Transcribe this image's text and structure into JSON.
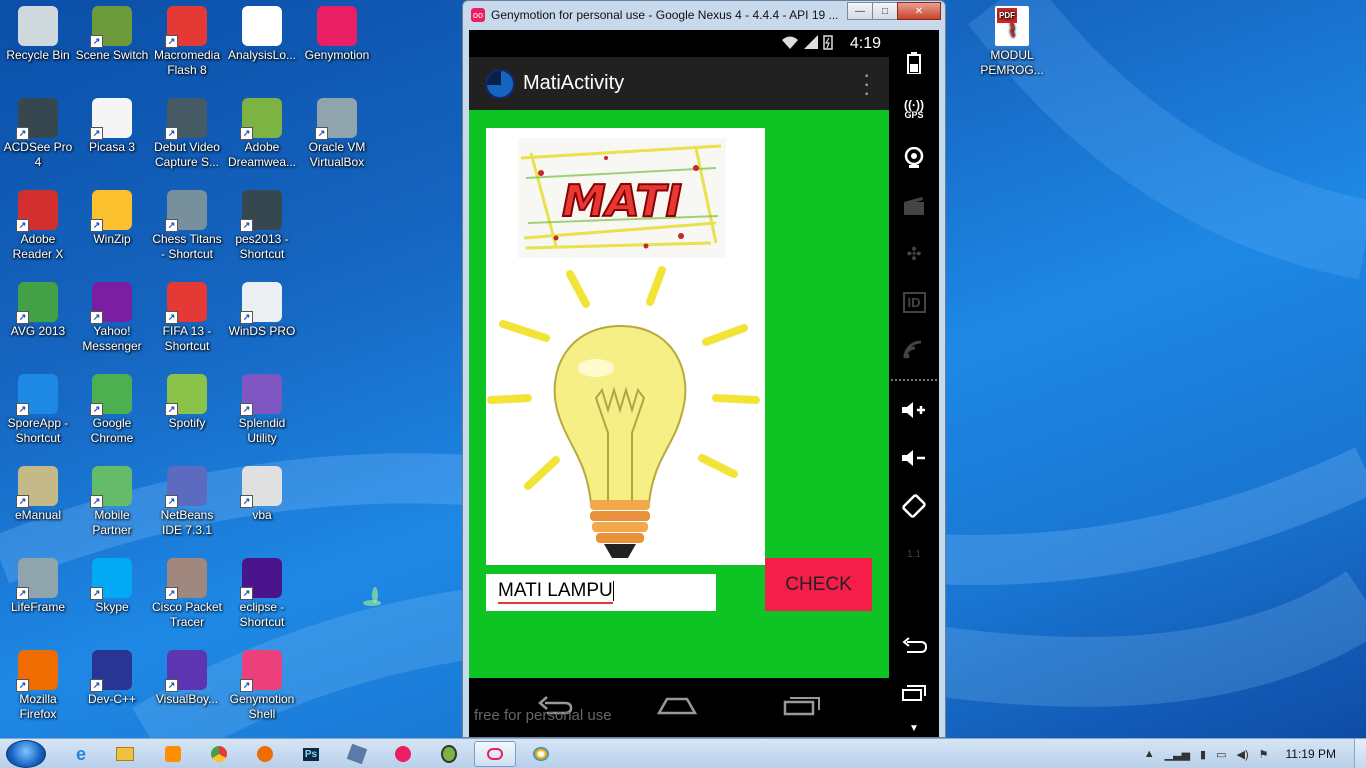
{
  "desktop": {
    "col1": [
      {
        "label": "Recycle Bin",
        "icon": "recycle-bin-icon",
        "color": "#cfd8dc"
      },
      {
        "label": "ACDSee Pro 4",
        "icon": "acdsee-icon",
        "color": "#37474f"
      },
      {
        "label": "Adobe Reader X",
        "icon": "adobe-reader-icon",
        "color": "#d32f2f"
      },
      {
        "label": "AVG 2013",
        "icon": "avg-icon",
        "color": "#43a047"
      },
      {
        "label": "SporeApp - Shortcut",
        "icon": "sporeapp-icon",
        "color": "#1e88e5"
      },
      {
        "label": "eManual",
        "icon": "emanual-icon",
        "color": "#c5b98a"
      },
      {
        "label": "LifeFrame",
        "icon": "lifeframe-icon",
        "color": "#90a4ae"
      },
      {
        "label": "Mozilla Firefox",
        "icon": "firefox-icon",
        "color": "#ef6c00"
      }
    ],
    "col2": [
      {
        "label": "Scene Switch",
        "icon": "scene-switch-icon",
        "color": "#6d9b3c"
      },
      {
        "label": "Picasa 3",
        "icon": "picasa-icon",
        "color": "#f5f5f5"
      },
      {
        "label": "WinZip",
        "icon": "winzip-icon",
        "color": "#fbc02d"
      },
      {
        "label": "Yahoo! Messenger",
        "icon": "yahoo-messenger-icon",
        "color": "#7b1fa2"
      },
      {
        "label": "Google Chrome",
        "icon": "chrome-icon",
        "color": "#4caf50"
      },
      {
        "label": "Mobile Partner",
        "icon": "mobile-partner-icon",
        "color": "#66bb6a"
      },
      {
        "label": "Skype",
        "icon": "skype-icon",
        "color": "#03a9f4"
      },
      {
        "label": "Dev-C++",
        "icon": "dev-cpp-icon",
        "color": "#283593"
      }
    ],
    "col3": [
      {
        "label": "Macromedia Flash 8",
        "icon": "flash-icon",
        "color": "#e53935"
      },
      {
        "label": "Debut Video Capture S...",
        "icon": "debut-video-icon",
        "color": "#455a64"
      },
      {
        "label": "Chess Titans - Shortcut",
        "icon": "chess-titans-icon",
        "color": "#78909c"
      },
      {
        "label": "FIFA 13 - Shortcut",
        "icon": "fifa-icon",
        "color": "#e53935"
      },
      {
        "label": "Spotify",
        "icon": "spotify-icon",
        "color": "#8bc34a"
      },
      {
        "label": "NetBeans IDE 7.3.1",
        "icon": "netbeans-icon",
        "color": "#5c6bc0"
      },
      {
        "label": "Cisco Packet Tracer",
        "icon": "cisco-packet-tracer-icon",
        "color": "#a1887f"
      },
      {
        "label": "VisualBoy...",
        "icon": "visualboy-icon",
        "color": "#5e35b1"
      }
    ],
    "col4": [
      {
        "label": "AnalysisLo...",
        "icon": "document-icon",
        "color": "#ffffff"
      },
      {
        "label": "Adobe Dreamwea...",
        "icon": "dreamweaver-icon",
        "color": "#7cb342"
      },
      {
        "label": "pes2013 - Shortcut",
        "icon": "pes2013-icon",
        "color": "#37474f"
      },
      {
        "label": "WinDS PRO",
        "icon": "winds-pro-icon",
        "color": "#eceff1"
      },
      {
        "label": "Splendid Utility",
        "icon": "splendid-icon",
        "color": "#7e57c2"
      },
      {
        "label": "vba",
        "icon": "vba-file-icon",
        "color": "#e0e0e0"
      },
      {
        "label": "eclipse - Shortcut",
        "icon": "eclipse-icon",
        "color": "#4a148c"
      },
      {
        "label": "Genymotion Shell",
        "icon": "genymotion-shell-icon",
        "color": "#ec407a"
      }
    ],
    "col5": [
      {
        "label": "Genymotion",
        "icon": "genymotion-icon",
        "color": "#e91e63"
      },
      {
        "label": "Oracle VM VirtualBox",
        "icon": "virtualbox-icon",
        "color": "#90a4ae"
      }
    ],
    "right_icon": {
      "label": "MODUL PEMROG...",
      "icon": "pdf-file-icon",
      "badge": "PDF"
    }
  },
  "window": {
    "title": "Genymotion for personal use - Google Nexus 4 - 4.4.4 - API 19 ...",
    "logo": "oo",
    "minimize": "—",
    "maximize": "□",
    "close": "✕"
  },
  "android": {
    "time": "4:19",
    "status_icons": "▾ ▮",
    "app_title": "MatiActivity",
    "image_caption": "MATI",
    "input_value": "MATI LAMPU",
    "check_label": "CHECK",
    "watermark": "free for personal use"
  },
  "toolbar": {
    "gps": "GPS",
    "id": "ID",
    "zoom": "1:1"
  },
  "taskbar": {
    "clock": "11:19 PM"
  }
}
